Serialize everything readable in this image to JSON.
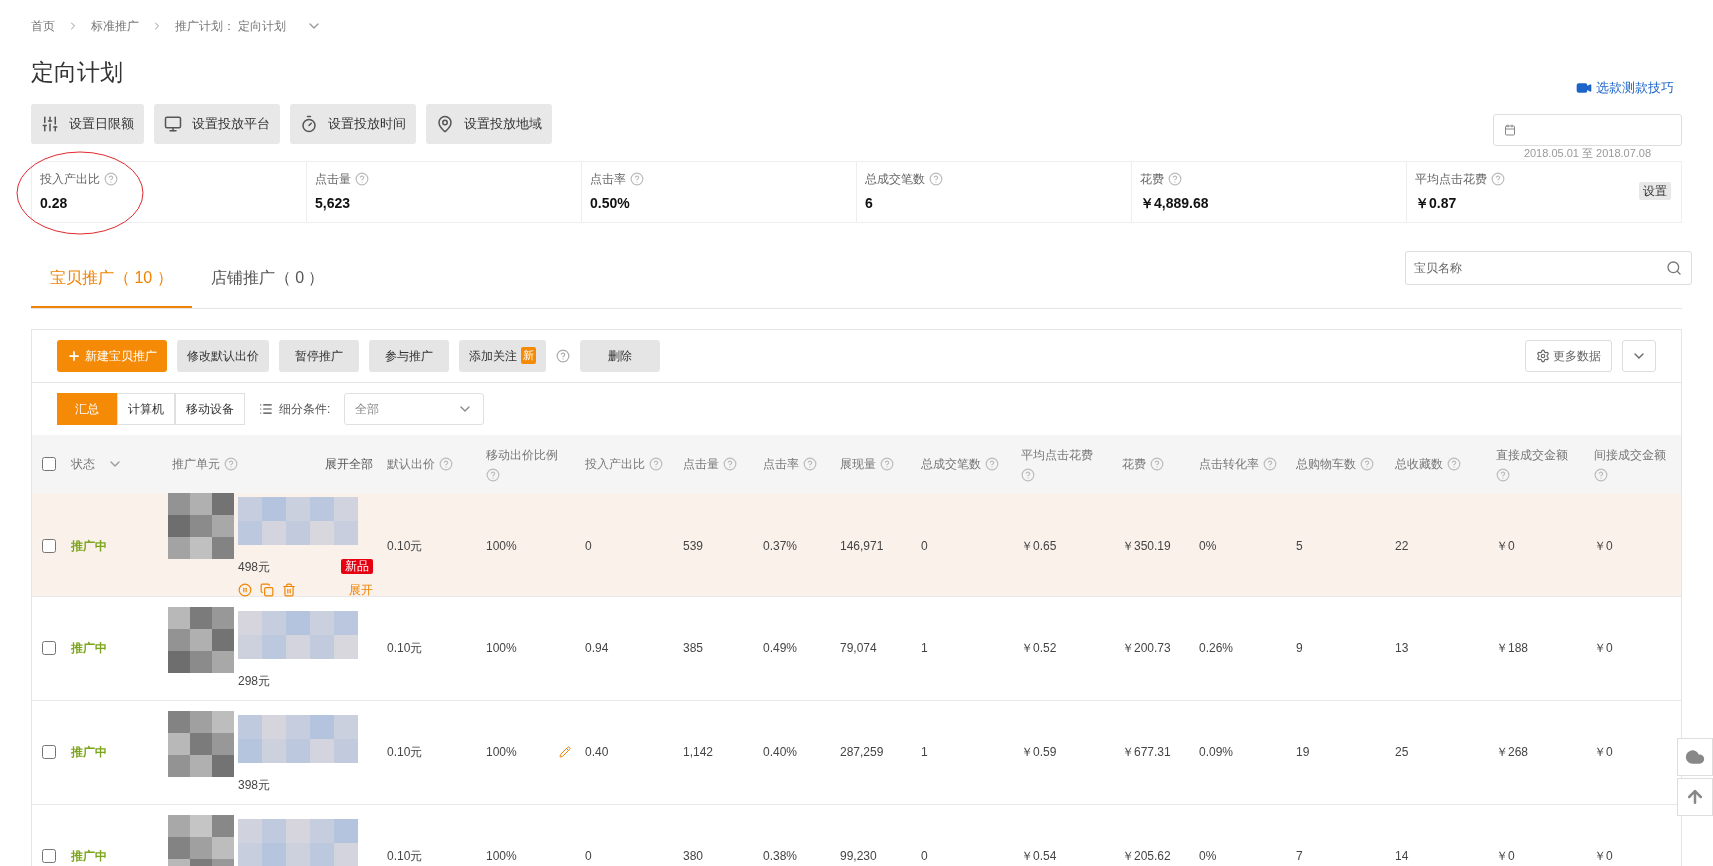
{
  "breadcrumb": [
    {
      "label": "首页"
    },
    {
      "label": "标准推广"
    },
    {
      "label": "推广计划： 定向计划"
    }
  ],
  "title": "定向计划",
  "tip_link": "选款测款技巧",
  "settings_buttons": [
    {
      "label": "设置日限额",
      "kind": "sliders"
    },
    {
      "label": "设置投放平台",
      "kind": "monitor"
    },
    {
      "label": "设置投放时间",
      "kind": "timer"
    },
    {
      "label": "设置投放地域",
      "kind": "map"
    }
  ],
  "date_range": "2018.05.01 至 2018.07.08",
  "kpis": [
    {
      "label": "投入产出比",
      "value": "0.28"
    },
    {
      "label": "点击量",
      "value": "5,623"
    },
    {
      "label": "点击率",
      "value": "0.50%"
    },
    {
      "label": "总成交笔数",
      "value": "6"
    },
    {
      "label": "花费",
      "value": "￥4,889.68"
    },
    {
      "label": "平均点击花费",
      "value": "￥0.87"
    }
  ],
  "kpi_settings": "设置",
  "tabs": [
    {
      "label": "宝贝推广（ 10 ）",
      "selected": true
    },
    {
      "label": "店铺推广（ 0 ）",
      "selected": false
    }
  ],
  "search": {
    "placeholder": "宝贝名称"
  },
  "actions": [
    {
      "label": "新建宝贝推广",
      "kind": "primary"
    },
    {
      "label": "修改默认出价",
      "kind": "default"
    },
    {
      "label": "暂停推广",
      "kind": "default"
    },
    {
      "label": "参与推广",
      "kind": "default"
    },
    {
      "label": "添加关注",
      "kind": "default",
      "badge": "新",
      "help": true
    },
    {
      "label": "删除",
      "kind": "default"
    }
  ],
  "more_data": "更多数据",
  "views": [
    {
      "label": "汇总",
      "selected": true
    },
    {
      "label": "计算机",
      "selected": false
    },
    {
      "label": "移动设备",
      "selected": false
    }
  ],
  "filter": {
    "label": "细分条件:",
    "value": "全部"
  },
  "table": {
    "columns": [
      {
        "label": "状态",
        "kind": "dropdown"
      },
      {
        "label": "推广单元",
        "kind": "help"
      },
      {
        "label": "默认出价",
        "kind": "help"
      },
      {
        "label": "移动出价比例",
        "kind": "help"
      },
      {
        "label": "投入产出比",
        "kind": "help"
      },
      {
        "label": "点击量",
        "kind": "help"
      },
      {
        "label": "点击率",
        "kind": "help"
      },
      {
        "label": "展现量",
        "kind": "help"
      },
      {
        "label": "总成交笔数",
        "kind": "help"
      },
      {
        "label": "平均点击花费",
        "kind": "help"
      },
      {
        "label": "花费",
        "kind": "help"
      },
      {
        "label": "点击转化率",
        "kind": "help"
      },
      {
        "label": "总购物车数",
        "kind": "help"
      },
      {
        "label": "总收藏数",
        "kind": "help"
      },
      {
        "label": "直接成交金额",
        "kind": "help"
      },
      {
        "label": "间接成交金额",
        "kind": "help"
      }
    ],
    "expand_all": "展开全部",
    "all_checked": false,
    "rows": [
      {
        "checked": false,
        "highlighted": true,
        "status": "推广中",
        "price": "498元",
        "badge": "新品",
        "tools": true,
        "expand": "展开",
        "bid": "0.10元",
        "mobile": "100%",
        "editable": false,
        "values": [
          "0",
          "539",
          "0.37%",
          "146,971",
          "0",
          "￥0.65",
          "￥350.19",
          "0%",
          "5",
          "22",
          "￥0",
          "￥0"
        ]
      },
      {
        "checked": false,
        "highlighted": false,
        "status": "推广中",
        "price": "298元",
        "tools": false,
        "bid": "0.10元",
        "mobile": "100%",
        "editable": false,
        "values": [
          "0.94",
          "385",
          "0.49%",
          "79,074",
          "1",
          "￥0.52",
          "￥200.73",
          "0.26%",
          "9",
          "13",
          "￥188",
          "￥0"
        ]
      },
      {
        "checked": false,
        "highlighted": false,
        "status": "推广中",
        "price": "398元",
        "tools": false,
        "bid": "0.10元",
        "mobile": "100%",
        "editable": true,
        "values": [
          "0.40",
          "1,142",
          "0.40%",
          "287,259",
          "1",
          "￥0.59",
          "￥677.31",
          "0.09%",
          "19",
          "25",
          "￥268",
          "￥0"
        ]
      },
      {
        "checked": false,
        "highlighted": false,
        "status": "推广中",
        "tools": false,
        "bid": "0.10元",
        "mobile": "100%",
        "editable": false,
        "values": [
          "0",
          "380",
          "0.38%",
          "99,230",
          "0",
          "￥0.54",
          "￥205.62",
          "0%",
          "7",
          "14",
          "￥0",
          "￥0"
        ]
      }
    ]
  }
}
